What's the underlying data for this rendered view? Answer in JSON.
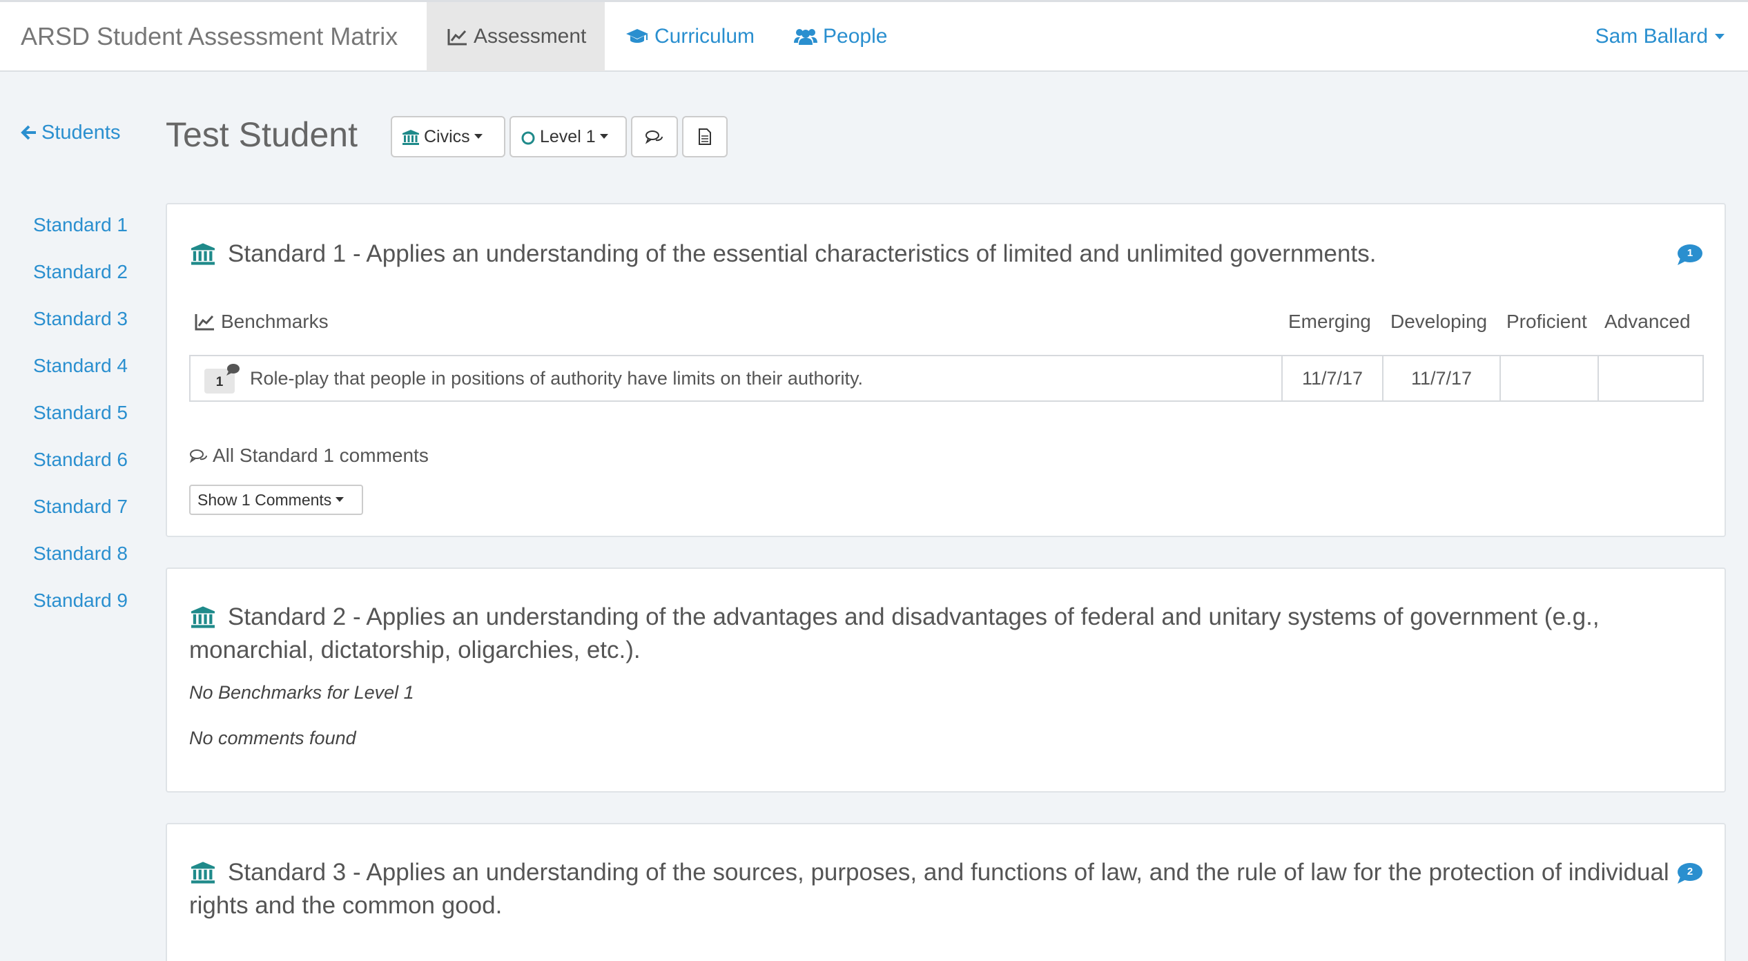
{
  "navbar": {
    "brand": "ARSD Student Assessment Matrix",
    "items": [
      {
        "label": "Assessment",
        "icon": "line-chart-icon",
        "active": true
      },
      {
        "label": "Curriculum",
        "icon": "graduation-cap-icon"
      },
      {
        "label": "People",
        "icon": "users-icon"
      }
    ],
    "user": "Sam Ballard"
  },
  "header": {
    "back_label": "Students",
    "student_name": "Test Student",
    "subject_label": "Civics",
    "level_label": "Level 1"
  },
  "sidebar": {
    "items": [
      "Standard 1",
      "Standard 2",
      "Standard 3",
      "Standard 4",
      "Standard 5",
      "Standard 6",
      "Standard 7",
      "Standard 8",
      "Standard 9"
    ]
  },
  "standards": [
    {
      "title": "Standard 1 - Applies an understanding of the essential characteristics of limited and unlimited governments.",
      "comment_count": "1",
      "benchmarks_label": "Benchmarks",
      "columns": [
        "Emerging",
        "Developing",
        "Proficient",
        "Advanced"
      ],
      "benchmarks": [
        {
          "number": "1",
          "text": "Role-play that people in positions of authority have limits on their authority.",
          "emerging": "11/7/17",
          "developing": "11/7/17",
          "proficient": "",
          "advanced": ""
        }
      ],
      "all_comments_label": "All Standard 1 comments",
      "show_comments_label": "Show 1 Comments"
    },
    {
      "title": "Standard 2 - Applies an understanding of the advantages and disadvantages of federal and unitary systems of government (e.g., monarchial, dictatorship, oligarchies, etc.).",
      "no_benchmarks": "No Benchmarks for Level 1",
      "no_comments": "No comments found"
    },
    {
      "title": "Standard 3 - Applies an understanding of the sources, purposes, and functions of law, and the rule of law for the protection of individual rights and the common good.",
      "comment_count": "2"
    }
  ],
  "colors": {
    "link": "#2a8fcf",
    "icon_teal": "#1f8a8a",
    "badge": "#2a8fcf",
    "background": "#f1f4f7"
  }
}
